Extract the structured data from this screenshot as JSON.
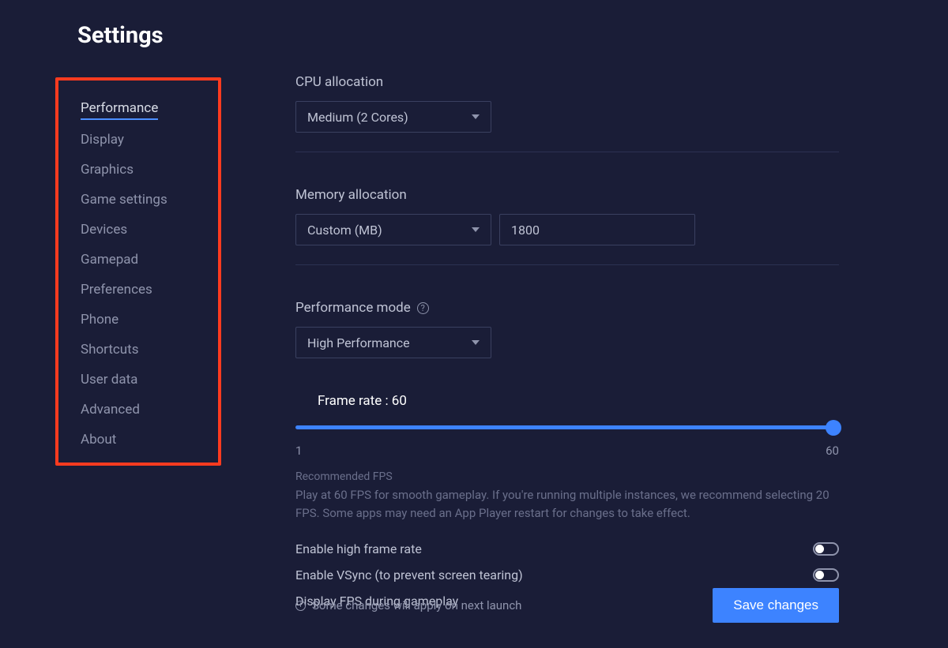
{
  "title": "Settings",
  "sidebar": {
    "items": [
      {
        "label": "Performance",
        "active": true
      },
      {
        "label": "Display"
      },
      {
        "label": "Graphics"
      },
      {
        "label": "Game settings"
      },
      {
        "label": "Devices"
      },
      {
        "label": "Gamepad"
      },
      {
        "label": "Preferences"
      },
      {
        "label": "Phone"
      },
      {
        "label": "Shortcuts"
      },
      {
        "label": "User data"
      },
      {
        "label": "Advanced"
      },
      {
        "label": "About"
      }
    ]
  },
  "cpu": {
    "label": "CPU allocation",
    "value": "Medium (2 Cores)"
  },
  "memory": {
    "label": "Memory allocation",
    "value": "Custom (MB)",
    "custom_value": "1800"
  },
  "perf_mode": {
    "label": "Performance mode",
    "value": "High Performance"
  },
  "frame": {
    "label": "Frame rate : 60",
    "min": "1",
    "max": "60",
    "value": 60,
    "rec_title": "Recommended FPS",
    "rec_body": "Play at 60 FPS for smooth gameplay. If you're running multiple instances, we recommend selecting 20 FPS. Some apps may need an App Player restart for changes to take effect."
  },
  "toggles": {
    "high_fps": "Enable high frame rate",
    "vsync": "Enable VSync (to prevent screen tearing)",
    "display_fps": "Display FPS during gameplay"
  },
  "footer": {
    "note": "Some changes will apply on next launch",
    "save": "Save changes"
  }
}
